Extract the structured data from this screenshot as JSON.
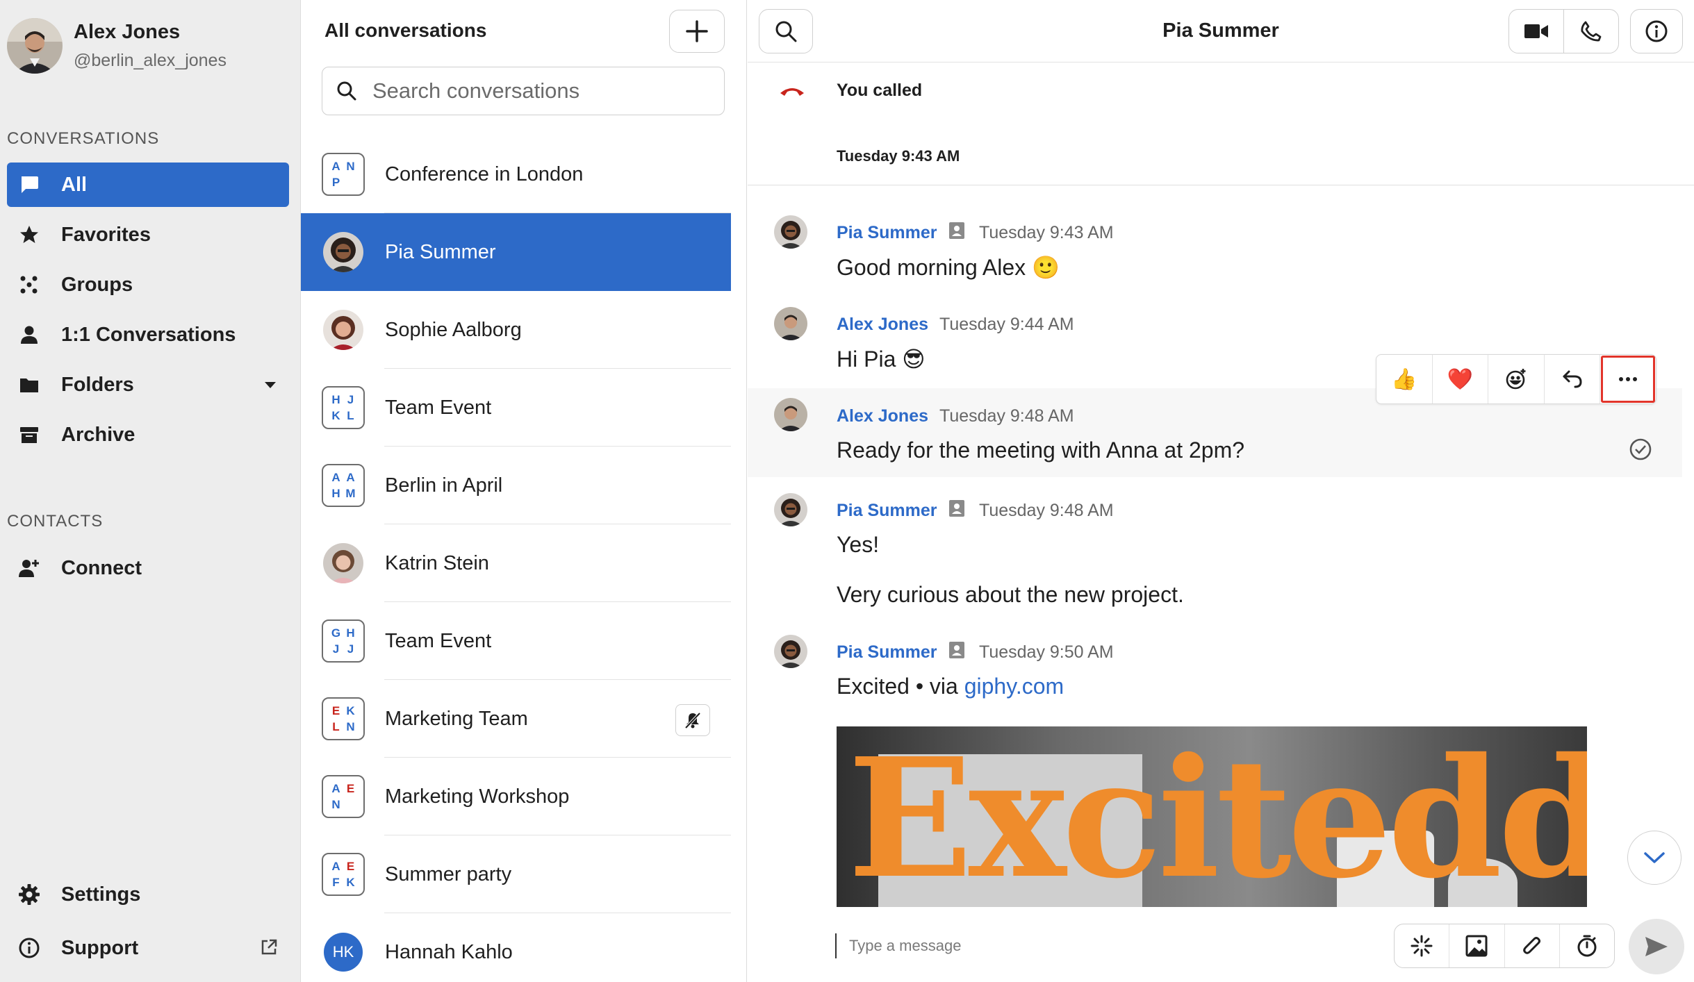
{
  "profile": {
    "name": "Alex Jones",
    "handle": "@berlin_alex_jones"
  },
  "sidebar": {
    "conversations_label": "CONVERSATIONS",
    "items": [
      {
        "label": "All",
        "icon": "chat-bubble-icon",
        "active": true
      },
      {
        "label": "Favorites",
        "icon": "star-icon"
      },
      {
        "label": "Groups",
        "icon": "groups-icon"
      },
      {
        "label": "1:1 Conversations",
        "icon": "person-icon"
      },
      {
        "label": "Folders",
        "icon": "folder-icon"
      },
      {
        "label": "Archive",
        "icon": "archive-icon"
      }
    ],
    "contacts_label": "CONTACTS",
    "connect_label": "Connect",
    "settings_label": "Settings",
    "support_label": "Support"
  },
  "conversation_list": {
    "title": "All conversations",
    "search_placeholder": "Search conversations",
    "items": [
      {
        "name": "Conference in London",
        "type": "group",
        "initials": [
          "A",
          "N",
          "P",
          ""
        ]
      },
      {
        "name": "Pia Summer",
        "type": "person",
        "selected": true
      },
      {
        "name": "Sophie Aalborg",
        "type": "person"
      },
      {
        "name": "Team Event",
        "type": "group",
        "initials": [
          "H",
          "J",
          "K",
          "L"
        ]
      },
      {
        "name": "Berlin in April",
        "type": "group",
        "initials": [
          "A",
          "A",
          "H",
          "M"
        ]
      },
      {
        "name": "Katrin Stein",
        "type": "person"
      },
      {
        "name": "Team Event",
        "type": "group",
        "initials": [
          "G",
          "H",
          "J",
          "J"
        ]
      },
      {
        "name": "Marketing Team",
        "type": "group",
        "initials": [
          "E",
          "K",
          "L",
          "N"
        ],
        "muted": true
      },
      {
        "name": "Marketing Workshop",
        "type": "group",
        "initials": [
          "A",
          "E",
          "N",
          ""
        ]
      },
      {
        "name": "Summer party",
        "type": "group",
        "initials": [
          "A",
          "E",
          "F",
          "K"
        ]
      },
      {
        "name": "Hannah Kahlo",
        "type": "initials",
        "initials_text": "HK"
      }
    ]
  },
  "chat": {
    "title": "Pia Summer",
    "call_notice": "You called",
    "day_stamp": "Tuesday 9:43 AM",
    "messages": [
      {
        "author": "Pia Summer",
        "time": "Tuesday 9:43 AM",
        "text": "Good morning Alex",
        "emoji": "🙂"
      },
      {
        "author": "Alex Jones",
        "time": "Tuesday 9:44 AM",
        "text": "Hi Pia",
        "emoji": "😎"
      },
      {
        "author": "Alex Jones",
        "time": "Tuesday 9:48 AM",
        "text": "Ready for the meeting with Anna at 2pm?"
      },
      {
        "author": "Pia Summer",
        "time": "Tuesday 9:48 AM",
        "text": "Yes!",
        "text2": "Very curious about the new project."
      },
      {
        "author": "Pia Summer",
        "time": "Tuesday 9:50 AM",
        "text": "Excited",
        "via": "• via",
        "link": "giphy.com"
      }
    ],
    "reactions": [
      "👍",
      "❤️"
    ],
    "gif_text": "Excitedd",
    "composer_placeholder": "Type a message"
  },
  "colors": {
    "accent": "#2d6ac8",
    "sidebar_bg": "#ededed",
    "highlight": "#e2342a",
    "gif_orange": "#ef8c2c"
  }
}
